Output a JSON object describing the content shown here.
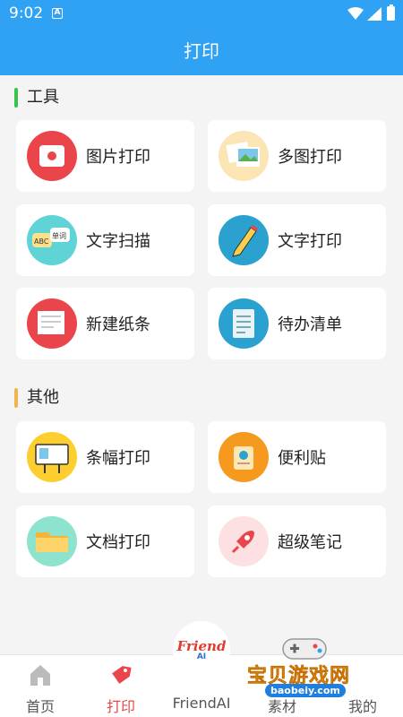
{
  "status_bar": {
    "time": "9:02",
    "app_badge": "A"
  },
  "header": {
    "title": "打印"
  },
  "sections": {
    "tools": {
      "title": "工具"
    },
    "other": {
      "title": "其他"
    }
  },
  "cards": {
    "photo_print": "图片打印",
    "multi_photo_print": "多图打印",
    "text_scan": "文字扫描",
    "text_print": "文字打印",
    "new_note": "新建纸条",
    "todo_list": "待办清单",
    "banner_print": "条幅打印",
    "sticky_note": "便利贴",
    "document_print": "文档打印",
    "super_note": "超级笔记"
  },
  "icon_text": {
    "scan_left": "ABC",
    "scan_right": "单词"
  },
  "tabs": {
    "home": "首页",
    "print": "打印",
    "friendai": "FriendAI",
    "tab4": "素材",
    "mine": "我的"
  },
  "friend_logo": {
    "word": "Friend",
    "sub": "AI"
  },
  "watermark": {
    "text": "宝贝游戏网",
    "url": "baobeiy.com"
  },
  "colors": {
    "primary": "#2fa2f3",
    "active_tab": "#e9454b",
    "tools_accent": "#38c34b",
    "other_accent": "#f0b64c"
  }
}
